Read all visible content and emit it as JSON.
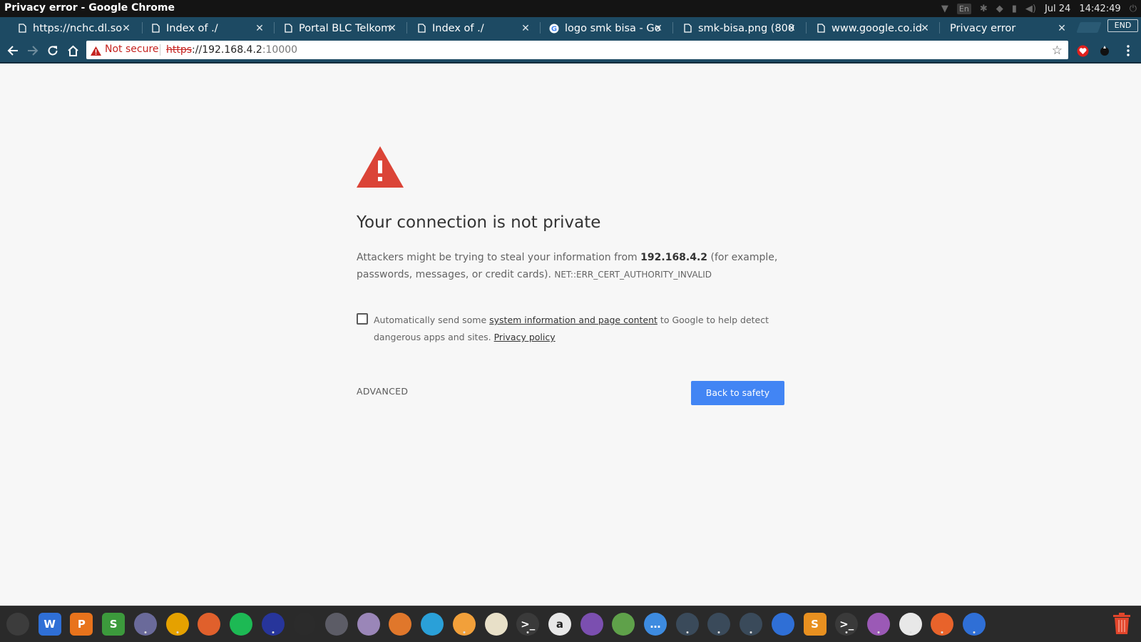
{
  "window": {
    "title": "Privacy error - Google Chrome"
  },
  "system_tray": {
    "language": "En",
    "date": "Jul 24",
    "time": "14:42:49"
  },
  "tabs": [
    {
      "label": "https://nchc.dl.so",
      "icon": "document-icon",
      "active": false
    },
    {
      "label": "Index of ./",
      "icon": "document-icon",
      "active": false
    },
    {
      "label": "Portal BLC Telkom",
      "icon": "document-icon",
      "active": false
    },
    {
      "label": "Index of ./",
      "icon": "document-icon",
      "active": false
    },
    {
      "label": "logo smk bisa - Go",
      "icon": "google-icon",
      "active": false
    },
    {
      "label": "smk-bisa.png (800",
      "icon": "document-icon",
      "active": false
    },
    {
      "label": "www.google.co.id",
      "icon": "document-icon",
      "active": false
    },
    {
      "label": "Privacy error",
      "icon": "none",
      "active": true
    }
  ],
  "tabstrip": {
    "end_label": "END"
  },
  "omnibox": {
    "security_label": "Not secure",
    "scheme": "https",
    "separator": "://",
    "host": "192.168.4.2",
    "port": ":10000"
  },
  "page": {
    "heading": "Your connection is not private",
    "explanation_prefix": "Attackers might be trying to steal your information from ",
    "explanation_host": "192.168.4.2",
    "explanation_suffix": " (for example, passwords, messages, or credit cards). ",
    "error_code": "NET::ERR_CERT_AUTHORITY_INVALID",
    "report_prefix": "Automatically send some ",
    "report_link": "system information and page content",
    "report_suffix": " to Google to help detect dangerous apps and sites. ",
    "privacy_link": "Privacy policy",
    "report_checked": false,
    "advanced_label": "ADVANCED",
    "back_button_label": "Back to safety"
  },
  "colors": {
    "chrome_frame": "#1d4a63",
    "warning_red": "#db4437",
    "not_secure_red": "#c5221f",
    "primary_button": "#4285f4"
  },
  "dock": {
    "apps": [
      {
        "name": "ubuntu-launcher",
        "glyph": "",
        "color": "#3c3c3c"
      },
      {
        "name": "wps-writer",
        "glyph": "W",
        "color": "#2f6fd6"
      },
      {
        "name": "wps-presentation",
        "glyph": "P",
        "color": "#e8731c"
      },
      {
        "name": "wps-spreadsheets",
        "glyph": "S",
        "color": "#3c9a3c"
      },
      {
        "name": "files",
        "glyph": "",
        "color": "#6a6a9a"
      },
      {
        "name": "chrome",
        "glyph": "",
        "color": "#e5a100"
      },
      {
        "name": "firefox",
        "glyph": "",
        "color": "#e0602c"
      },
      {
        "name": "spotify",
        "glyph": "",
        "color": "#1db954"
      },
      {
        "name": "app-blue",
        "glyph": "",
        "color": "#27359b"
      },
      {
        "name": "inkscape",
        "glyph": "",
        "color": "#2b2b2b"
      },
      {
        "name": "app-grey",
        "glyph": "",
        "color": "#5c5c66"
      },
      {
        "name": "app-purple",
        "glyph": "",
        "color": "#9a86b8"
      },
      {
        "name": "app-orange",
        "glyph": "",
        "color": "#e0772b"
      },
      {
        "name": "telegram",
        "glyph": "",
        "color": "#2aa0d8"
      },
      {
        "name": "software-center",
        "glyph": "",
        "color": "#f2a03a"
      },
      {
        "name": "app-cream",
        "glyph": "",
        "color": "#e8e0c8"
      },
      {
        "name": "terminal",
        "glyph": ">_",
        "color": "#3a3a3a"
      },
      {
        "name": "amazon",
        "glyph": "a",
        "color": "#e8e8e8"
      },
      {
        "name": "feather",
        "glyph": "",
        "color": "#7b4fb0"
      },
      {
        "name": "image-viewer",
        "glyph": "",
        "color": "#5fa14a"
      },
      {
        "name": "chat",
        "glyph": "…",
        "color": "#3d8be0"
      },
      {
        "name": "app-magnifier-1",
        "glyph": "",
        "color": "#3a4a5a"
      },
      {
        "name": "app-magnifier-2",
        "glyph": "",
        "color": "#3a4a5a"
      },
      {
        "name": "app-magnifier-3",
        "glyph": "",
        "color": "#3a4a5a"
      },
      {
        "name": "list-app",
        "glyph": "",
        "color": "#2f6fd6"
      },
      {
        "name": "sublime",
        "glyph": "S",
        "color": "#e89020"
      },
      {
        "name": "terminal-2",
        "glyph": ">_",
        "color": "#3a3a3a"
      },
      {
        "name": "text-editor",
        "glyph": "",
        "color": "#9b59b6"
      },
      {
        "name": "app-signature",
        "glyph": "",
        "color": "#e8e8e8"
      },
      {
        "name": "app-orange-2",
        "glyph": "",
        "color": "#e8632b"
      },
      {
        "name": "app-globe",
        "glyph": "",
        "color": "#2f6fd6"
      }
    ]
  }
}
